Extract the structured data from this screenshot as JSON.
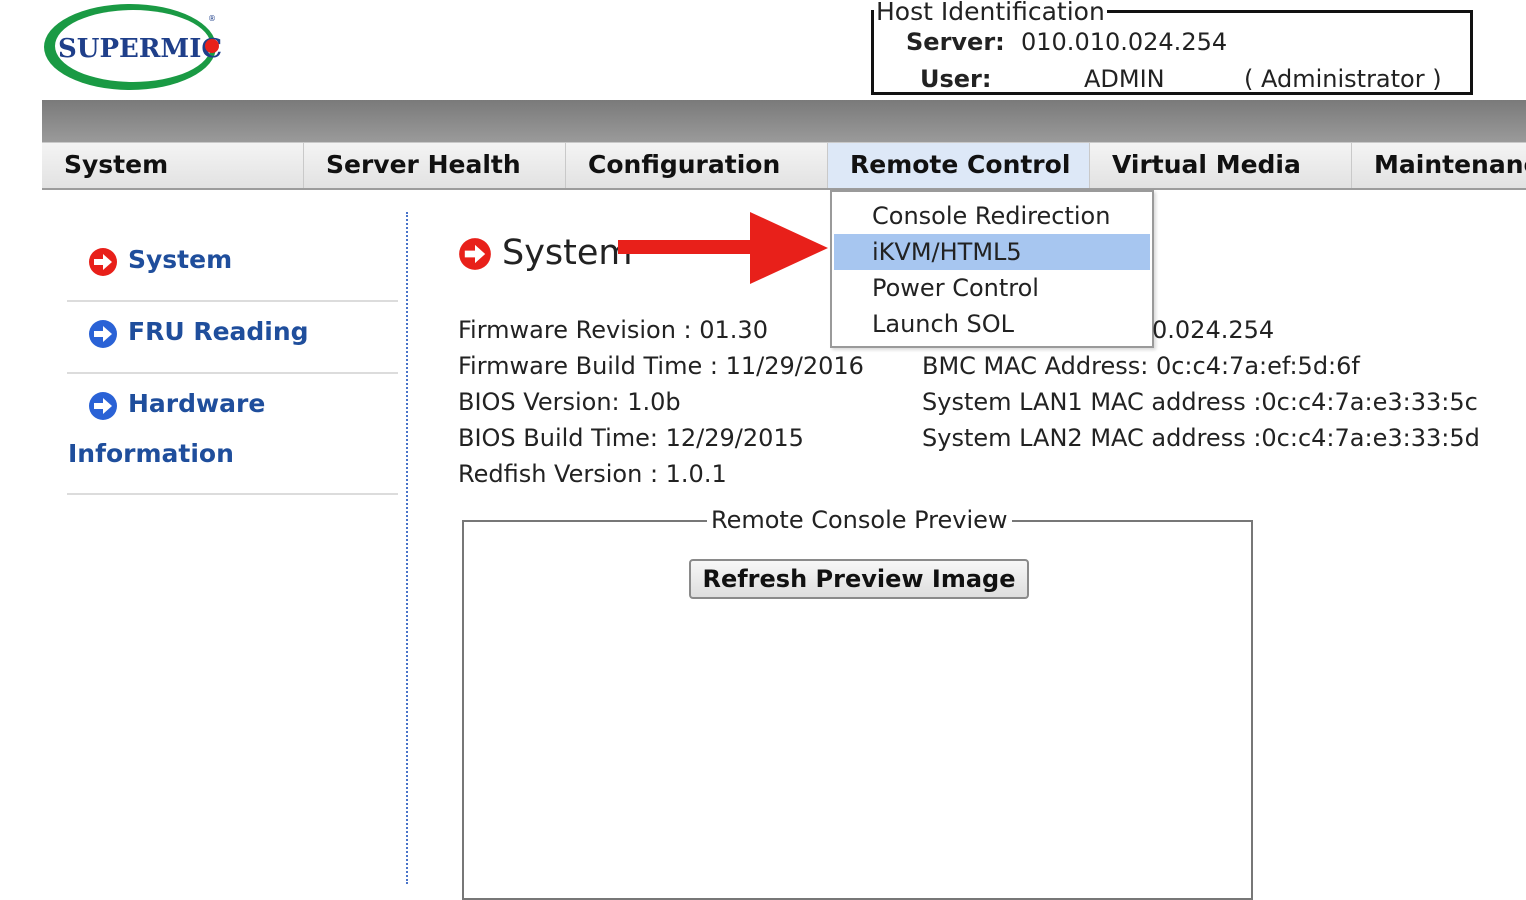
{
  "logo": {
    "text": "SUPERMICR",
    "name": "supermicro-logo"
  },
  "host": {
    "legend": "Host Identification",
    "server_label": "Server:",
    "server_value": "010.010.024.254",
    "user_label": "User:",
    "user_value": "ADMIN",
    "user_role": "( Administrator )"
  },
  "menu": [
    {
      "label": "System"
    },
    {
      "label": "Server Health"
    },
    {
      "label": "Configuration"
    },
    {
      "label": "Remote Control",
      "active": true
    },
    {
      "label": "Virtual Media"
    },
    {
      "label": "Maintenance"
    }
  ],
  "dropdown": [
    {
      "label": "Console Redirection"
    },
    {
      "label": "iKVM/HTML5",
      "highlighted": true
    },
    {
      "label": "Power Control"
    },
    {
      "label": "Launch SOL"
    }
  ],
  "sidebar": [
    {
      "label": "System",
      "icon": "arrow-right-circle-red-icon"
    },
    {
      "label": "FRU Reading",
      "icon": "arrow-right-circle-blue-icon"
    },
    {
      "label": "Hardware",
      "label2": "Information",
      "icon": "arrow-right-circle-blue-icon"
    }
  ],
  "main": {
    "title": "System",
    "left_info": [
      "Firmware Revision :  01.30",
      "Firmware Build Time :  11/29/2016",
      "BIOS Version: 1.0b",
      "BIOS Build Time: 12/29/2015",
      "Redfish Version : 1.0.1"
    ],
    "right_info": [
      "0.024.254",
      "BMC MAC Address:  0c:c4:7a:ef:5d:6f",
      "System LAN1 MAC address :0c:c4:7a:e3:33:5c",
      "System LAN2 MAC address :0c:c4:7a:e3:33:5d"
    ],
    "preview_legend": "Remote Console Preview",
    "refresh_button": "Refresh Preview Image"
  },
  "colors": {
    "link_blue": "#1f4e9c",
    "menu_highlight": "#a7c6f0",
    "arrow_red": "#e8201a",
    "logo_green": "#1a9a44"
  }
}
